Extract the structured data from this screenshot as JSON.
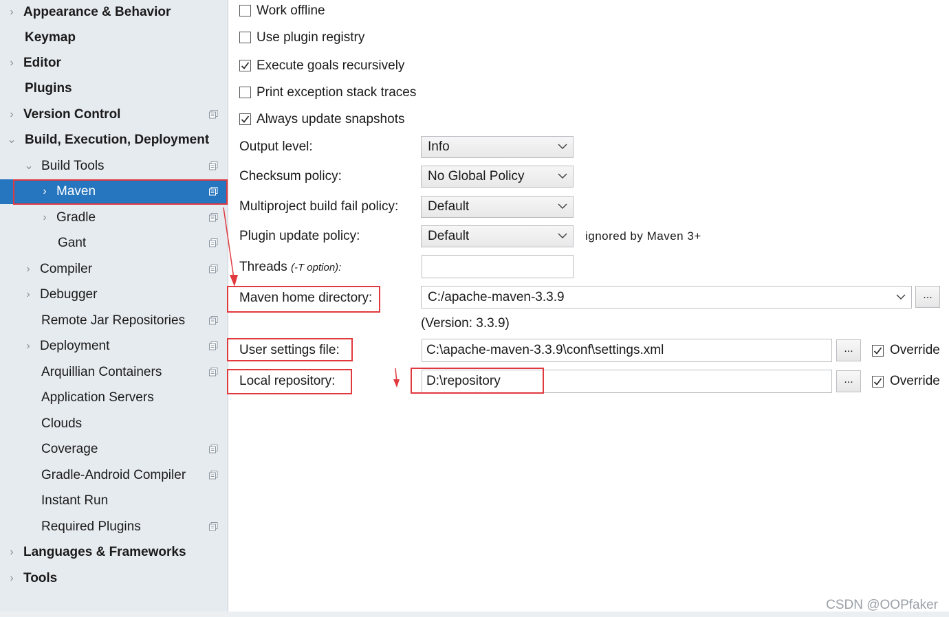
{
  "sidebar": {
    "items": [
      {
        "label": "Appearance & Behavior",
        "chevron": ">"
      },
      {
        "label": "Keymap",
        "chevron": ""
      },
      {
        "label": "Editor",
        "chevron": ">"
      },
      {
        "label": "Plugins",
        "chevron": ""
      },
      {
        "label": "Version Control",
        "chevron": ">"
      },
      {
        "label": "Build, Execution, Deployment",
        "chevron": "v"
      },
      {
        "label": "Build Tools",
        "chevron": "v"
      },
      {
        "label": "Maven",
        "chevron": ">"
      },
      {
        "label": "Gradle",
        "chevron": ">"
      },
      {
        "label": "Gant",
        "chevron": ""
      },
      {
        "label": "Compiler",
        "chevron": ">"
      },
      {
        "label": "Debugger",
        "chevron": ">"
      },
      {
        "label": "Remote Jar Repositories",
        "chevron": ""
      },
      {
        "label": "Deployment",
        "chevron": ">"
      },
      {
        "label": "Arquillian Containers",
        "chevron": ""
      },
      {
        "label": "Application Servers",
        "chevron": ""
      },
      {
        "label": "Clouds",
        "chevron": ""
      },
      {
        "label": "Coverage",
        "chevron": ""
      },
      {
        "label": "Gradle-Android Compiler",
        "chevron": ""
      },
      {
        "label": "Instant Run",
        "chevron": ""
      },
      {
        "label": "Required Plugins",
        "chevron": ""
      },
      {
        "label": "Languages & Frameworks",
        "chevron": ">"
      },
      {
        "label": "Tools",
        "chevron": ">"
      }
    ],
    "selected": "Maven",
    "project_icon": "project-settings-icon"
  },
  "checkboxes": [
    {
      "label": "Work offline",
      "checked": false
    },
    {
      "label": "Use plugin registry",
      "checked": false
    },
    {
      "label": "Execute goals recursively",
      "checked": true
    },
    {
      "label": "Print exception stack traces",
      "checked": false
    },
    {
      "label": "Always update snapshots",
      "checked": true
    }
  ],
  "fields": {
    "output_level": {
      "label": "Output level:",
      "value": "Info"
    },
    "checksum_policy": {
      "label": "Checksum policy:",
      "value": "No Global Policy"
    },
    "multiproject_fail_policy": {
      "label": "Multiproject build fail policy:",
      "value": "Default"
    },
    "plugin_update_policy": {
      "label": "Plugin update policy:",
      "value": "Default",
      "note": "ignored by Maven 3+"
    },
    "threads": {
      "label": "Threads",
      "hint": "(-T option):",
      "value": ""
    },
    "maven_home": {
      "label": "Maven home directory:",
      "value": "C:/apache-maven-3.3.9",
      "version": "(Version: 3.3.9)",
      "browse": "..."
    },
    "user_settings": {
      "label": "User settings file:",
      "value": "C:\\apache-maven-3.3.9\\conf\\settings.xml",
      "browse": "...",
      "override_label": "Override",
      "override_checked": true
    },
    "local_repo": {
      "label": "Local repository:",
      "value": "D:\\repository",
      "browse": "...",
      "override_label": "Override",
      "override_checked": true
    }
  },
  "watermark": "CSDN @OOPfaker",
  "colors": {
    "highlight": "#e0393e",
    "selection": "#2675bf",
    "sidebar_bg": "#e6ebf0"
  }
}
